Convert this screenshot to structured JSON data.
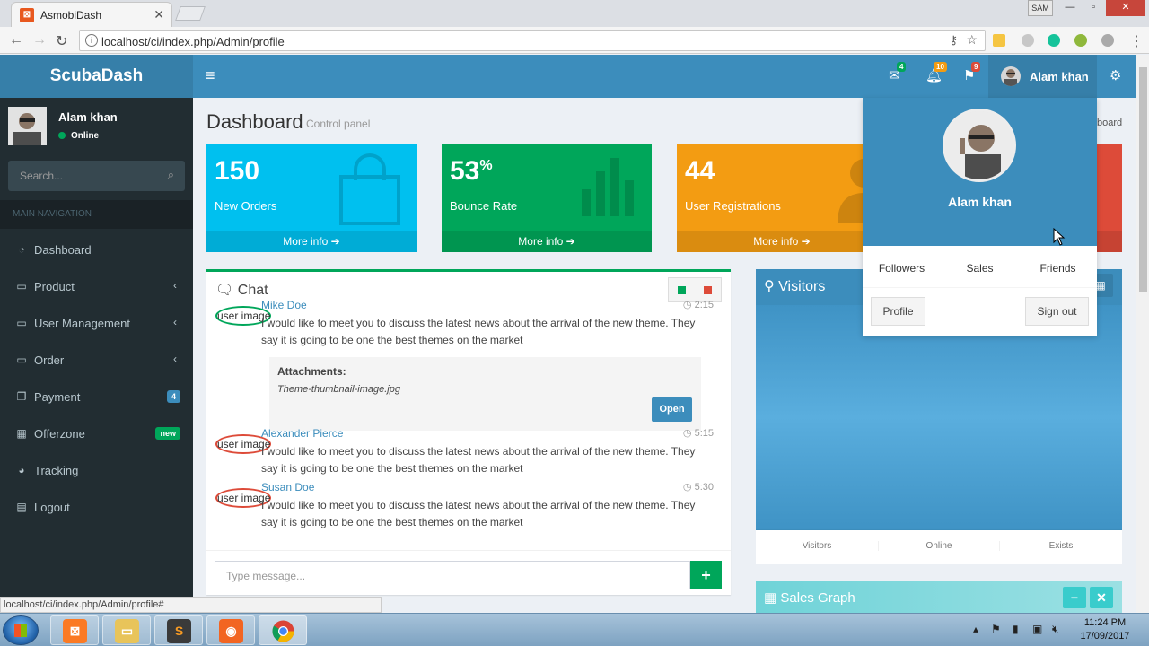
{
  "browser": {
    "tab_title": "AsmobiDash",
    "tab_close": "✕",
    "url": "localhost/ci/index.php/Admin/profile",
    "win_user": "SAM"
  },
  "app": {
    "logo": "ScubaDash",
    "top_badges": {
      "mail": "4",
      "bell": "10",
      "flag": "9"
    },
    "header_user": "Alam khan"
  },
  "sidebar": {
    "user_name": "Alam khan",
    "status": "Online",
    "search_placeholder": "Search...",
    "section_header": "MAIN NAVIGATION",
    "items": [
      {
        "label": "Dashboard",
        "icon": "dashboard-icon"
      },
      {
        "label": "Product",
        "icon": "laptop-icon",
        "chevron": "‹"
      },
      {
        "label": "User Management",
        "icon": "laptop-icon",
        "chevron": "‹"
      },
      {
        "label": "Order",
        "icon": "laptop-icon",
        "chevron": "‹"
      },
      {
        "label": "Payment",
        "icon": "files-icon",
        "badge": "4",
        "badge_color": "#3c8dbc"
      },
      {
        "label": "Offerzone",
        "icon": "grid-icon",
        "badge": "new",
        "badge_color": "#00a65a"
      },
      {
        "label": "Tracking",
        "icon": "pie-chart-icon"
      },
      {
        "label": "Logout",
        "icon": "table-icon"
      }
    ]
  },
  "status_bar_url": "localhost/ci/index.php/Admin/profile#",
  "content": {
    "title": "Dashboard",
    "subtitle": "Control panel",
    "breadcrumb_tail": "board",
    "stat_boxes": [
      {
        "value": "150",
        "sup": "",
        "label": "New Orders",
        "footer": "More info",
        "color": "#00c0ef"
      },
      {
        "value": "53",
        "sup": "%",
        "label": "Bounce Rate",
        "footer": "More info",
        "color": "#00a65a"
      },
      {
        "value": "44",
        "sup": "",
        "label": "User Registrations",
        "footer": "More info",
        "color": "#f39c12"
      }
    ],
    "chat": {
      "title": "Chat",
      "messages": [
        {
          "user_image_label": "user image",
          "name": "Mike Doe",
          "time": "2:15",
          "text": "I would like to meet you to discuss the latest news about the arrival of the new theme. They say it is going to be one the best themes on the market",
          "ring": "#00a65a"
        },
        {
          "user_image_label": "user image",
          "name": "Alexander Pierce",
          "time": "5:15",
          "text": "I would like to meet you to discuss the latest news about the arrival of the new theme. They say it is going to be one the best themes on the market",
          "ring": "#dd4b39"
        },
        {
          "user_image_label": "user image",
          "name": "Susan Doe",
          "time": "5:30",
          "text": "I would like to meet you to discuss the latest news about the arrival of the new theme. They say it is going to be one the best themes on the market",
          "ring": "#dd4b39"
        }
      ],
      "attachment": {
        "heading": "Attachments:",
        "file": "Theme-thumbnail-image.jpg",
        "button": "Open"
      },
      "input_placeholder": "Type message...",
      "send": "+"
    },
    "visitors": {
      "title": "Visitors",
      "stats": [
        "Visitors",
        "Online",
        "Exists"
      ]
    },
    "sales_graph": {
      "title": "Sales Graph",
      "minus": "−",
      "close": "✕"
    }
  },
  "user_dropdown": {
    "name": "Alam khan",
    "links": [
      "Followers",
      "Sales",
      "Friends"
    ],
    "profile_button": "Profile",
    "signout_button": "Sign out"
  },
  "taskbar": {
    "time": "11:24 PM",
    "date": "17/09/2017"
  }
}
